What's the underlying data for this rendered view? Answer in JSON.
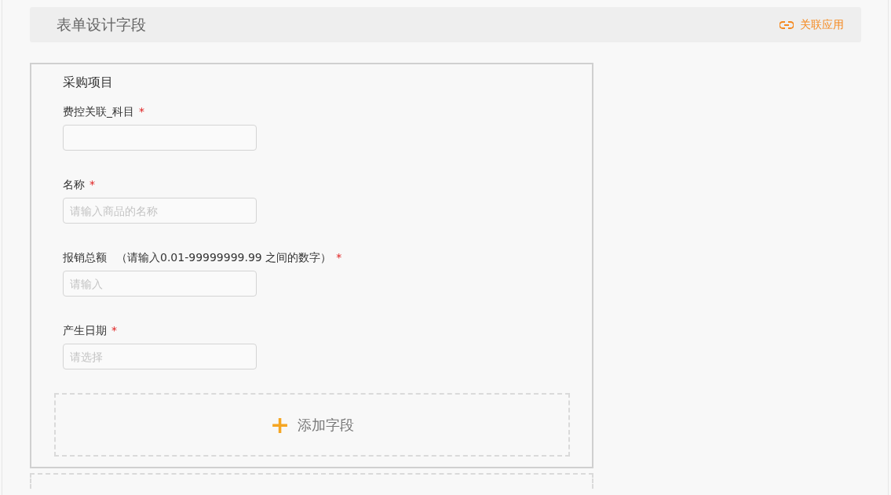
{
  "header": {
    "title": "表单设计字段",
    "link": "关联应用"
  },
  "section": {
    "title": "采购项目",
    "fields": [
      {
        "label": "费控关联_科目",
        "required_mark": "*"
      },
      {
        "label": "名称",
        "required_mark": "*",
        "placeholder": "请输入商品的名称"
      },
      {
        "label": "报销总额",
        "note": "（请输入0.01-99999999.99 之间的数字）",
        "required_mark": "*",
        "placeholder": "请输入"
      },
      {
        "label": "产生日期",
        "required_mark": "*",
        "placeholder": "请选择"
      }
    ],
    "add_button": {
      "icon": "+",
      "label": "添加字段"
    }
  }
}
